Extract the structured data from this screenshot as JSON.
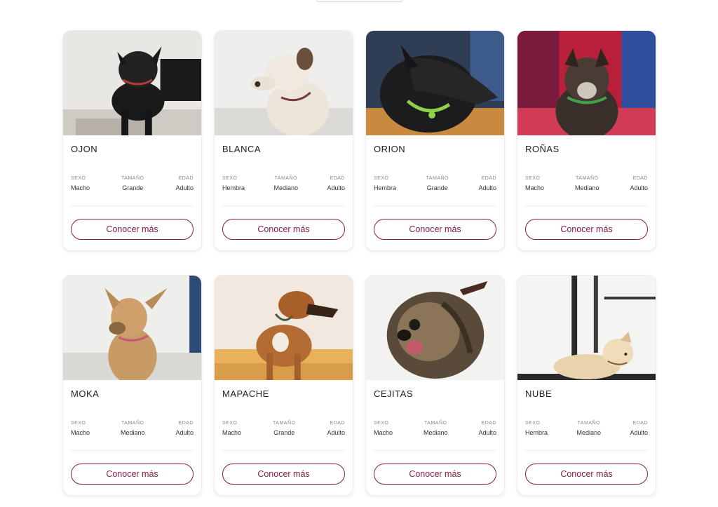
{
  "labels": {
    "sexo": "SEXO",
    "tamano": "TAMAÑO",
    "edad": "EDAD",
    "button": "Conocer más"
  },
  "accent_color": "#8b1a4c",
  "dogs": [
    {
      "name": "OJON",
      "sexo": "Macho",
      "tamano": "Grande",
      "edad": "Adulto",
      "photo": "dog-black-small"
    },
    {
      "name": "BLANCA",
      "sexo": "Hembra",
      "tamano": "Mediano",
      "edad": "Adulto",
      "photo": "dog-white"
    },
    {
      "name": "ORION",
      "sexo": "Hembra",
      "tamano": "Grande",
      "edad": "Adulto",
      "photo": "dog-black-profile"
    },
    {
      "name": "ROÑAS",
      "sexo": "Macho",
      "tamano": "Mediano",
      "edad": "Adulto",
      "photo": "dog-dark-colorful"
    },
    {
      "name": "MOKA",
      "sexo": "Macho",
      "tamano": "Mediano",
      "edad": "Adulto",
      "photo": "dog-tan"
    },
    {
      "name": "MAPACHE",
      "sexo": "Macho",
      "tamano": "Grande",
      "edad": "Adulto",
      "photo": "dog-brown-profile"
    },
    {
      "name": "CEJITAS",
      "sexo": "Macho",
      "tamano": "Mediano",
      "edad": "Adulto",
      "photo": "dog-scruffy"
    },
    {
      "name": "NUBE",
      "sexo": "Hembra",
      "tamano": "Mediano",
      "edad": "Adulto",
      "photo": "dog-cream"
    }
  ]
}
